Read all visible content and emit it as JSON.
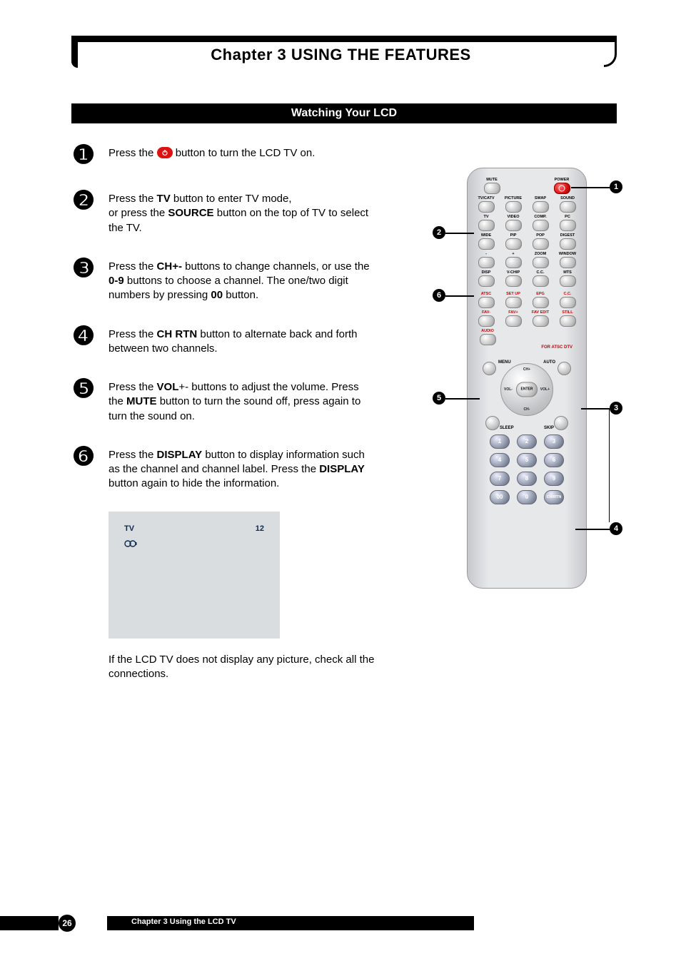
{
  "chapter_title": "Chapter 3 USING THE FEATURES",
  "section_title": "Watching Your LCD",
  "steps": {
    "s1": {
      "num": "❶",
      "pre": "Press the ",
      "post": " button to turn the LCD TV on."
    },
    "s2": {
      "num": "❷",
      "a": "Press the ",
      "b1": "TV",
      "c": " button to enter TV mode,",
      "d": "or press the ",
      "b2": "SOURCE",
      "e": " button on the top of TV to select the TV."
    },
    "s3": {
      "num": "❸",
      "a": "Press the ",
      "b1": "CH+-",
      "c": " buttons to change channels, or use the ",
      "b2": "0-9",
      "d": " buttons to choose a channel. The one/two digit numbers by pressing ",
      "b3": "00",
      "e": " button."
    },
    "s4": {
      "num": "❹",
      "a": "Press the ",
      "b1": "CH RTN",
      "c": " button to alternate back and forth between two channels."
    },
    "s5": {
      "num": "❺",
      "a": "Press the ",
      "b1": "VOL",
      "a2": "+- buttons to adjust the volume. Press the ",
      "b2": "MUTE",
      "c": " button to turn the sound off, press again to turn the sound on."
    },
    "s6": {
      "num": "❻",
      "a": "Press the ",
      "b1": "DISPLAY",
      "c": " button to display information such as the channel and channel label. Press the ",
      "b2": "DISPLAY",
      "d": " button again to hide the information."
    }
  },
  "osd": {
    "tv": "TV",
    "ch": "12"
  },
  "note": "If the LCD TV does not display any picture, check all the connections.",
  "remote": {
    "row_top": [
      "MUTE",
      "POWER"
    ],
    "row1": [
      "TV/CATV",
      "PICTURE",
      "SWAP",
      "SOUND"
    ],
    "row2": [
      "TV",
      "VIDEO",
      "COMP.",
      "PC"
    ],
    "row3": [
      "WIDE",
      "PIP",
      "POP",
      "DIGEST"
    ],
    "row4": [
      "-",
      "+",
      "ZOOM",
      "WINDOW"
    ],
    "row5": [
      "DISP",
      "V-CHIP",
      "C.C.",
      "MTS"
    ],
    "row6": [
      "ATSC",
      "SET UP",
      "EPG",
      "C.C."
    ],
    "row7": [
      "FAV-",
      "FAV+",
      "FAV EDIT",
      "STILL"
    ],
    "audio": "AUDIO",
    "for_atsc": "FOR ATSC DTV",
    "nav": {
      "menu": "MENU",
      "auto": "AUTO",
      "chp": "CH+",
      "chm": "CH-",
      "volm": "VOL-",
      "volp": "VOL+",
      "enter": "ENTER"
    },
    "under": {
      "sleep": "SLEEP",
      "skip": "SKIP"
    },
    "numpad": [
      [
        "1",
        "2",
        "3"
      ],
      [
        "4",
        "5",
        "6"
      ],
      [
        "7",
        "8",
        "9"
      ],
      [
        "00",
        "0",
        "CH/RTN"
      ]
    ]
  },
  "callouts": {
    "c1": "1",
    "c2": "2",
    "c3": "3",
    "c4": "4",
    "c5": "5",
    "c6": "6"
  },
  "footer": {
    "page": "26",
    "text": "Chapter 3 Using the LCD TV"
  }
}
